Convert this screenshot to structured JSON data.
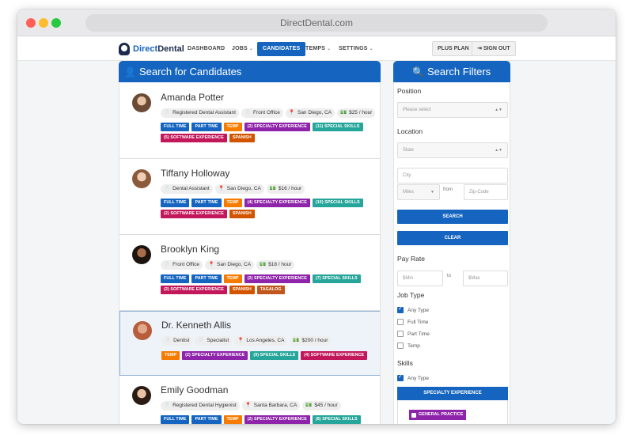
{
  "browser": {
    "url": "DirectDental.com"
  },
  "nav": {
    "logo_part1": "Direct",
    "logo_part2": "Dental",
    "items": [
      {
        "label": "DASHBOARD"
      },
      {
        "label": "JOBS",
        "caret": "⌄"
      },
      {
        "label": "CANDIDATES"
      },
      {
        "label": "TEMPS",
        "caret": "⌄"
      },
      {
        "label": "SETTINGS",
        "caret": "⌄"
      }
    ],
    "plus_plan": "PLUS PLAN",
    "sign_out": "SIGN OUT"
  },
  "candidates_panel": {
    "title": "Search for Candidates"
  },
  "candidates": [
    {
      "name": "Amanda Potter",
      "meta": [
        "Registered Dental Assistant",
        "Front Office"
      ],
      "location": "San Diego, CA",
      "rate": "$25 / hour",
      "tags": [
        "FULL TIME",
        "PART TIME",
        "TEMP",
        "(2) SPECIALTY EXPERIENCE",
        "(11) SPECIAL SKILLS",
        "(5) SOFTWARE EXPERIENCE",
        "SPANISH"
      ]
    },
    {
      "name": "Tiffany Holloway",
      "meta": [
        "Dental Assistant"
      ],
      "location": "San Diego, CA",
      "rate": "$16 / hour",
      "tags": [
        "FULL TIME",
        "PART TIME",
        "TEMP",
        "(4) SPECIALTY EXPERIENCE",
        "(10) SPECIAL SKILLS",
        "(2) SOFTWARE EXPERIENCE",
        "SPANISH"
      ]
    },
    {
      "name": "Brooklyn King",
      "meta": [
        "Front Office"
      ],
      "location": "San Diego, CA",
      "rate": "$18 / hour",
      "tags": [
        "FULL TIME",
        "PART TIME",
        "TEMP",
        "(2) SPECIALTY EXPERIENCE",
        "(7) SPECIAL SKILLS",
        "(2) SOFTWARE EXPERIENCE",
        "SPANISH",
        "TAGALOG"
      ]
    },
    {
      "name": "Dr. Kenneth Allis",
      "meta": [
        "Dentist",
        "Specialist"
      ],
      "location": "Los Angeles, CA",
      "rate": "$200 / hour",
      "tags": [
        "TEMP",
        "(2) SPECIALTY EXPERIENCE",
        "(9) SPECIAL SKILLS",
        "(4) SOFTWARE EXPERIENCE"
      ]
    },
    {
      "name": "Emily Goodman",
      "meta": [
        "Registered Dental Hygienist"
      ],
      "location": "Santa Barbara, CA",
      "rate": "$45 / hour",
      "tags": [
        "FULL TIME",
        "PART TIME",
        "TEMP",
        "(2) SPECIALTY EXPERIENCE",
        "(8) SPECIAL SKILLS"
      ]
    }
  ],
  "filters": {
    "title": "Search Filters",
    "position_label": "Position",
    "position_placeholder": "Please select",
    "location_label": "Location",
    "state_placeholder": "State",
    "city_placeholder": "City",
    "miles_placeholder": "Miles",
    "from_text": "from",
    "zip_placeholder": "Zip-Code",
    "search_button": "SEARCH",
    "clear_button": "CLEAR",
    "pay_rate_label": "Pay Rate",
    "min_placeholder": "$Min",
    "to_text": "to",
    "max_placeholder": "$Max",
    "job_type_label": "Job Type",
    "job_types": [
      {
        "label": "Any Type",
        "checked": true
      },
      {
        "label": "Full Time",
        "checked": false
      },
      {
        "label": "Part Time",
        "checked": false
      },
      {
        "label": "Temp",
        "checked": false
      }
    ],
    "skills_label": "Skills",
    "skills_any": "Any Type",
    "specialty_header": "SPECIALTY EXPERIENCE",
    "specialty_item": "GENERAL PRACTICE"
  },
  "colors": {
    "primary": "#1565c0",
    "temp_tag": "#f57c00",
    "specialty_tag": "#8e24aa",
    "skills_tag": "#26a69a",
    "software_tag": "#c2185b",
    "language_tag": "#d35400"
  }
}
